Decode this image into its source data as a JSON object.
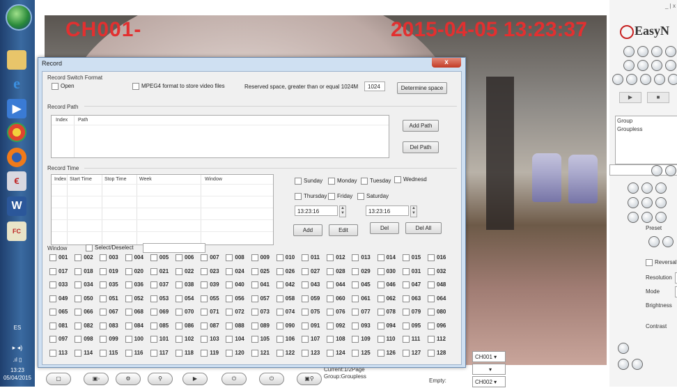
{
  "taskbar": {
    "tray_lang": "ES",
    "clock_time": "13:23",
    "clock_date": "05/04/2015"
  },
  "video": {
    "channel_label": "CH001-",
    "timestamp": "2015-04-05 13:23:37"
  },
  "panel": {
    "logo_text": "EasyN",
    "window_controls": "_ | x",
    "group_label": "Group",
    "group_value": "Groupless",
    "preset_label": "Preset",
    "reversal_label": "Reversal",
    "resolution_label": "Resolution",
    "mode_label": "Mode",
    "brightness_label": "Brightness",
    "contrast_label": "Contrast"
  },
  "bottom": {
    "status_page": "Current:1/2Page",
    "status_group": "Group:Groupless",
    "empty_label": "Empty:",
    "combo1": "CH001",
    "combo2": "CH002"
  },
  "dialog": {
    "title": "Record",
    "close": "x",
    "switch_format_label": "Record Switch  Format",
    "open_label": "Open",
    "mpeg4_label": "MPEG4 format to store video files",
    "reserved_label": "Reserved space, greater than or equal 1024M",
    "reserved_value": "1024",
    "determine_button": "Determine space",
    "record_path_label": "Record Path",
    "path_columns": [
      "Index",
      "Path"
    ],
    "add_path_button": "Add Path",
    "del_path_button": "Del Path",
    "record_time_label": "Record Time",
    "time_columns": [
      "Index",
      "Start Time",
      "Stop Time",
      "Week",
      "Window"
    ],
    "days_row1": [
      "Sunday",
      "Monday",
      "Tuesday",
      "Wednesd"
    ],
    "days_row2": [
      "Thursday",
      "Friday",
      "Saturday"
    ],
    "start_time": "13:23:16",
    "stop_time": "13:23:16",
    "add_button": "Add",
    "edit_button": "Edit",
    "del_button": "Del",
    "del_all_button": "Del All",
    "window_label": "Window",
    "select_deselect_label": "Select/Deselect",
    "channels": [
      "001",
      "002",
      "003",
      "004",
      "005",
      "006",
      "007",
      "008",
      "009",
      "010",
      "011",
      "012",
      "013",
      "014",
      "015",
      "016",
      "017",
      "018",
      "019",
      "020",
      "021",
      "022",
      "023",
      "024",
      "025",
      "026",
      "027",
      "028",
      "029",
      "030",
      "031",
      "032",
      "033",
      "034",
      "035",
      "036",
      "037",
      "038",
      "039",
      "040",
      "041",
      "042",
      "043",
      "044",
      "045",
      "046",
      "047",
      "048",
      "049",
      "050",
      "051",
      "052",
      "053",
      "054",
      "055",
      "056",
      "057",
      "058",
      "059",
      "060",
      "061",
      "062",
      "063",
      "064",
      "065",
      "066",
      "067",
      "068",
      "069",
      "070",
      "071",
      "072",
      "073",
      "074",
      "075",
      "076",
      "077",
      "078",
      "079",
      "080",
      "081",
      "082",
      "083",
      "084",
      "085",
      "086",
      "087",
      "088",
      "089",
      "090",
      "091",
      "092",
      "093",
      "094",
      "095",
      "096",
      "097",
      "098",
      "099",
      "100",
      "101",
      "102",
      "103",
      "104",
      "105",
      "106",
      "107",
      "108",
      "109",
      "110",
      "111",
      "112",
      "113",
      "114",
      "115",
      "116",
      "117",
      "118",
      "119",
      "120",
      "121",
      "122",
      "123",
      "124",
      "125",
      "126",
      "127",
      "128"
    ]
  }
}
